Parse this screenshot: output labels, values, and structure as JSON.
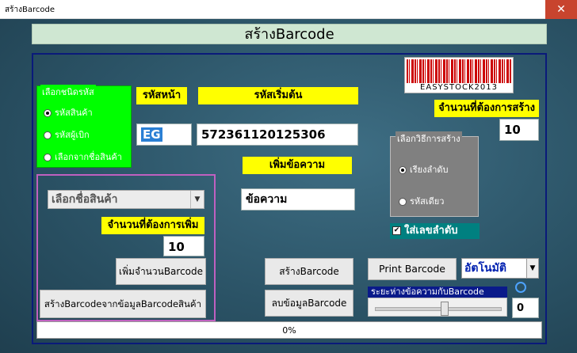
{
  "window": {
    "title": "สร้างBarcode",
    "close": "✕"
  },
  "header": {
    "title": "สร้างBarcode"
  },
  "barcode_logo": {
    "text": "EASYSTOCK2013"
  },
  "type_group": {
    "title": "เลือกชนิดรหัส",
    "options": [
      "รหัสสินค้า",
      "รหัสผู้เบิก",
      "เลือกจากชื่อสินค้า"
    ],
    "selected": 0
  },
  "prefix": {
    "label": "รหัสหน้า",
    "value": "EG"
  },
  "start_code": {
    "label": "รหัสเริ่มต้น",
    "value": "572361120125306"
  },
  "qty_create": {
    "label": "จำนวนที่ต้องการสร้าง",
    "value": "10"
  },
  "create_method": {
    "title": "เลือกวิธีการสร้าง",
    "options": [
      "เรียงลำดับ",
      "รหัสเดียว"
    ],
    "selected": 0
  },
  "add_text": {
    "label": "เพิ่มข้อความ",
    "value": "ข้อความ"
  },
  "product_select": {
    "value": "เลือกชื่อสินค้า"
  },
  "qty_add": {
    "label": "จำนวนที่ต้องการเพิ่ม",
    "value": "10"
  },
  "sequence_check": {
    "label": "ใส่เลขลำดับ",
    "checked": true,
    "mark": "✔"
  },
  "buttons": {
    "add_qty": "เพิ่มจำนวนBarcode",
    "create_from_product": "สร้างBarcodeจากข้อมูลBarcodeสินค้า",
    "create": "สร้างBarcode",
    "delete": "ลบข้อมูลBarcode",
    "print": "Print Barcode"
  },
  "print_mode": {
    "value": "อัตโนมัติ",
    "arrow": "▼"
  },
  "spacing": {
    "label": "ระยะห่างข้อความกับBarcode",
    "value": "0",
    "level": 0.55
  },
  "progress": {
    "text": "0%",
    "value": 0
  },
  "icons": {
    "dropdown_arrow": "▼"
  },
  "colors": {
    "accent_green": "#00ff00",
    "label_yellow": "#ffff00",
    "teal": "#008080",
    "navy": "#0a1a8a"
  }
}
